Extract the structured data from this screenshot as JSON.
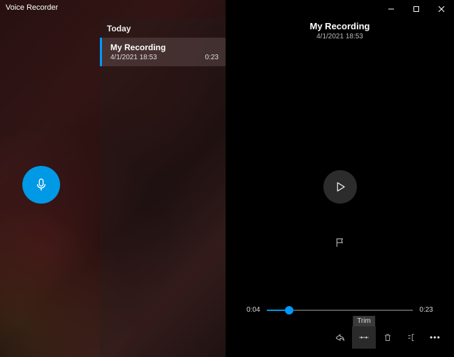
{
  "window": {
    "title": "Voice Recorder"
  },
  "list": {
    "section_label": "Today",
    "items": [
      {
        "title": "My Recording",
        "time": "4/1/2021 18:53",
        "duration": "0:23"
      }
    ]
  },
  "detail": {
    "title": "My Recording",
    "subtitle": "4/1/2021 18:53"
  },
  "playback": {
    "elapsed": "0:04",
    "total": "0:23",
    "progress_percent": 15
  },
  "actions": {
    "trim_tooltip": "Trim"
  },
  "colors": {
    "accent": "#0099e5"
  }
}
